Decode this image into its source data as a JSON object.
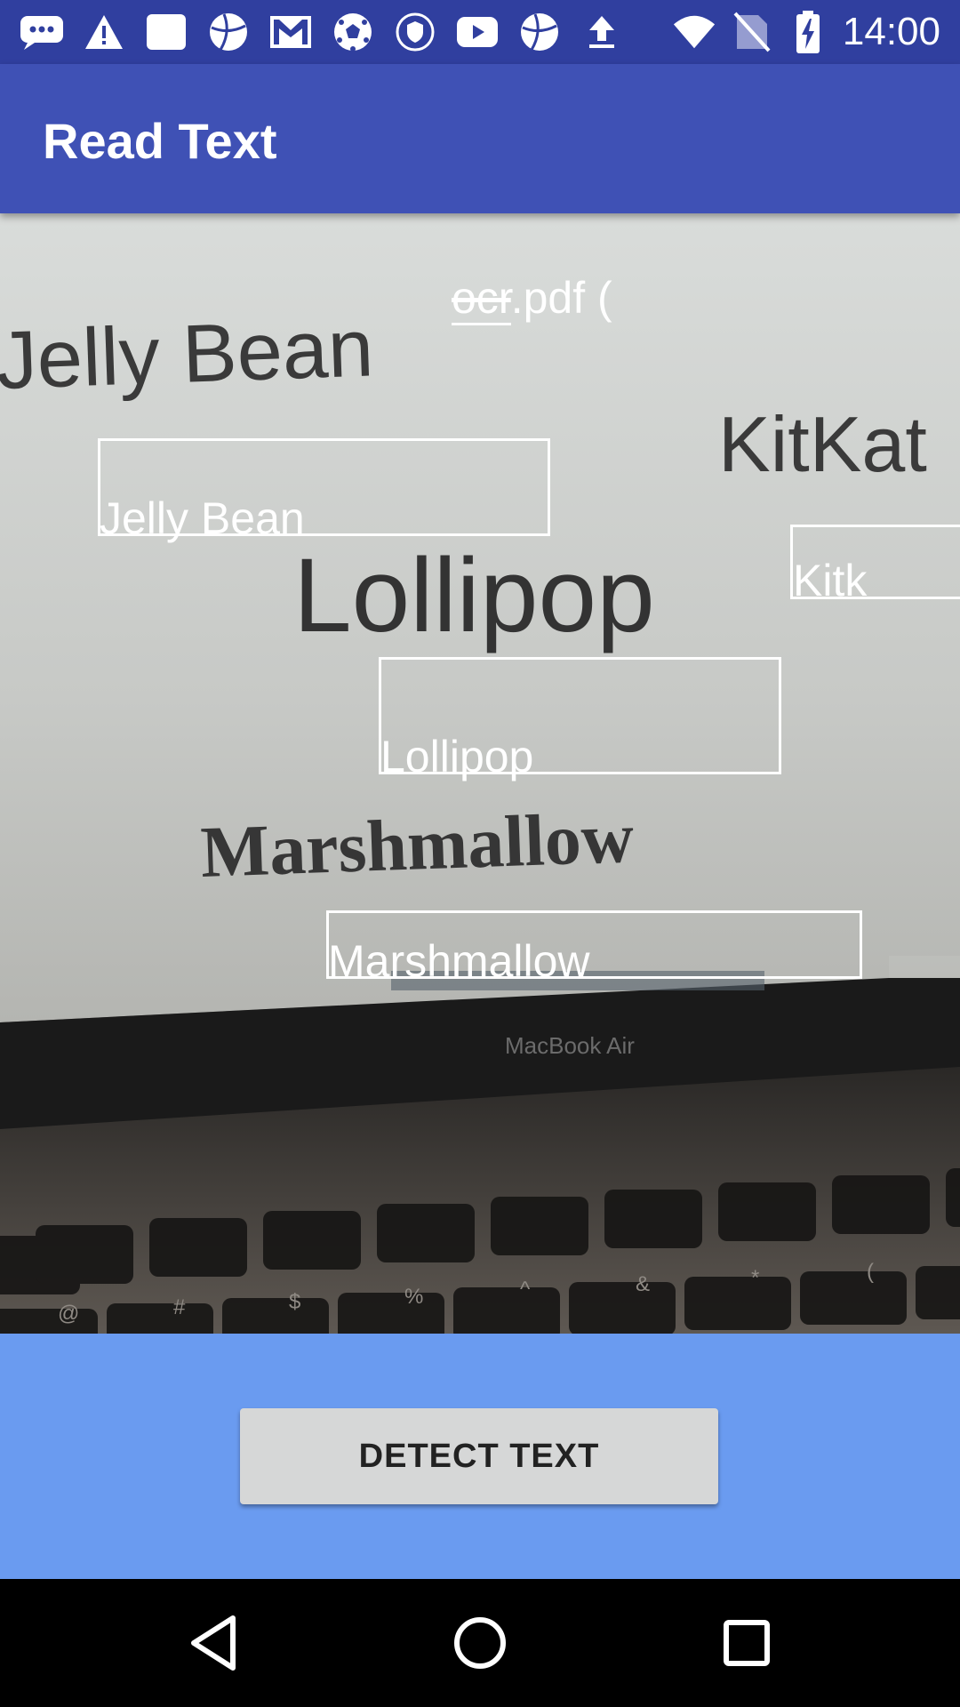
{
  "status_bar": {
    "time": "14:00",
    "notification_icons": [
      "messages-icon",
      "warning-icon",
      "app-icon",
      "ball-icon",
      "gmail-icon",
      "soccer-icon",
      "shield-icon",
      "youtube-icon",
      "ball-icon",
      "upload-icon"
    ],
    "system_icons": [
      "wifi-icon",
      "no-sim-icon",
      "battery-charging-icon"
    ]
  },
  "app_bar": {
    "title": "Read Text"
  },
  "camera_view": {
    "background_words": [
      "Jelly Bean",
      "KitKat",
      "Lollipop",
      "Marshmallow",
      "MacBook Air"
    ],
    "ocr_detections": [
      {
        "text": "ocr.pdf (",
        "strike": "ocr"
      },
      {
        "text": "Jelly Bean"
      },
      {
        "text": "Kitk"
      },
      {
        "text": "Lollipop"
      },
      {
        "text": "Marshmallow"
      }
    ]
  },
  "actions": {
    "detect_label": "DETECT TEXT"
  },
  "nav_bar": {
    "buttons": [
      "back",
      "home",
      "recents"
    ]
  },
  "colors": {
    "status": "#303f9f",
    "primary": "#3f51b5",
    "panel": "#6a9bf0",
    "button": "#d6d7d7"
  }
}
